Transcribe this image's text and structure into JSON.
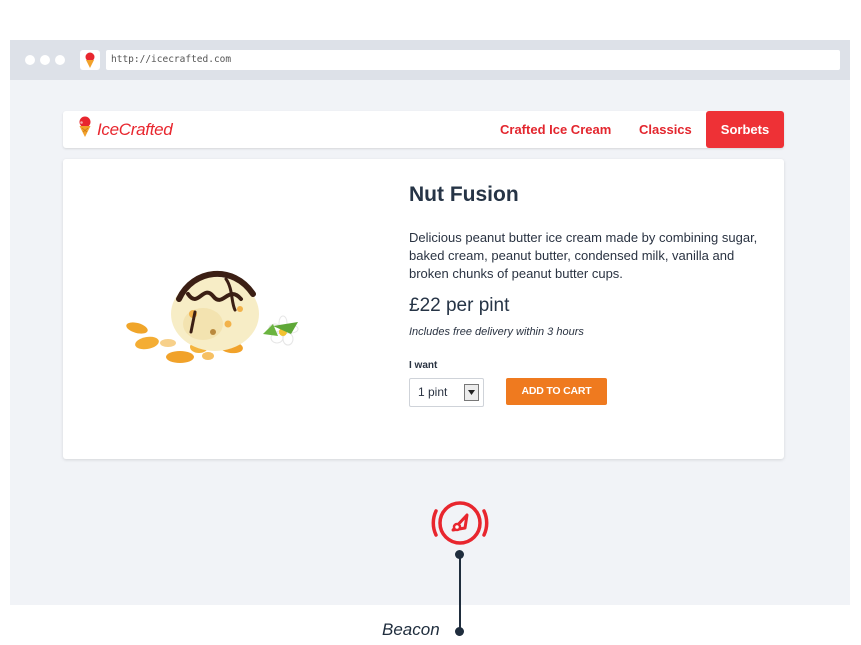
{
  "browser": {
    "url": "http://icecrafted.com"
  },
  "header": {
    "logo_text": "IceCrafted",
    "nav": [
      {
        "label": "Crafted Ice Cream"
      },
      {
        "label": "Classics"
      },
      {
        "label": "Sorbets"
      }
    ]
  },
  "product": {
    "title": "Nut Fusion",
    "description": "Delicious peanut butter ice cream made by combining sugar, baked cream, peanut butter, condensed milk, vanilla and broken chunks of peanut butter cups.",
    "price": "£22 per pint",
    "delivery": "Includes free delivery within 3 hours",
    "quantity_label": "I want",
    "quantity_value": "1 pint",
    "cart_button": "ADD TO CART"
  },
  "annotation": {
    "label": "Beacon",
    "icon": "gauge-icon"
  },
  "colors": {
    "brand_red": "#e8262e",
    "active_nav": "#ee3136",
    "cart_orange": "#ef7a1f",
    "text_dark": "#263446"
  }
}
